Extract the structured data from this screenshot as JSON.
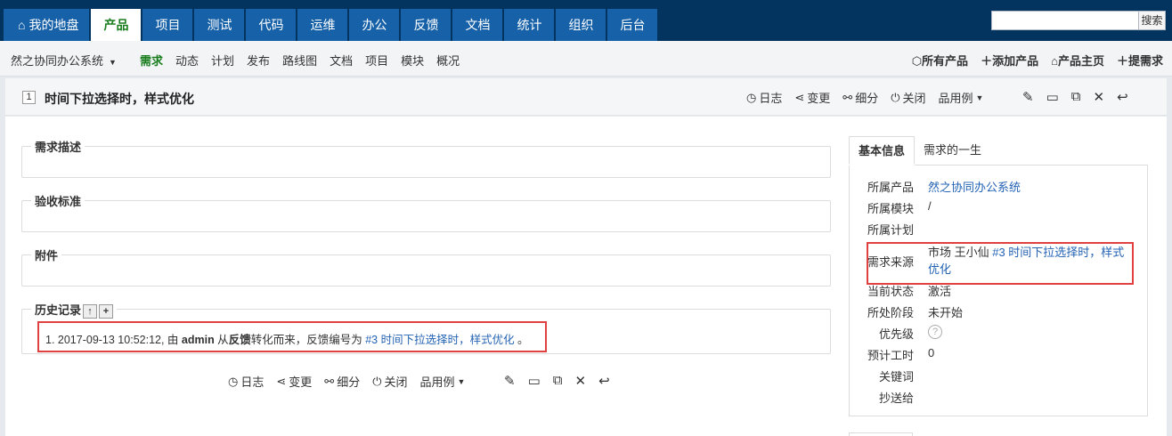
{
  "nav": {
    "tabs": [
      "我的地盘",
      "产品",
      "项目",
      "测试",
      "代码",
      "运维",
      "办公",
      "反馈",
      "文档",
      "统计",
      "组织",
      "后台"
    ],
    "active_tab": 1,
    "search_placeholder": "",
    "search_button": "搜索"
  },
  "subnav": {
    "product": "然之协同办公系统",
    "items": [
      "需求",
      "动态",
      "计划",
      "发布",
      "路线图",
      "文档",
      "项目",
      "模块",
      "概况"
    ],
    "active_item": 0,
    "right": [
      "所有产品",
      "添加产品",
      "产品主页",
      "提需求"
    ]
  },
  "story": {
    "id": "1",
    "title": "时间下拉选择时，样式优化",
    "actions": [
      "日志",
      "变更",
      "细分",
      "关闭",
      "品用例"
    ]
  },
  "sections": {
    "desc": "需求描述",
    "acceptance": "验收标准",
    "attachments": "附件",
    "history": "历史记录"
  },
  "history": {
    "prefix": "1. 2017-09-13 10:52:12, 由 ",
    "user": "admin",
    "mid1": " 从",
    "source": "反馈",
    "mid2": "转化而来，反馈编号为 ",
    "link": "#3 时间下拉选择时，样式优化",
    "suffix": " 。"
  },
  "side": {
    "tabs": [
      "基本信息",
      "需求的一生"
    ],
    "active_tab": 0,
    "fields": {
      "product_label": "所属产品",
      "product": "然之协同办公系统",
      "module_label": "所属模块",
      "module": "/",
      "plan_label": "所属计划",
      "plan": "",
      "source_label": "需求来源",
      "source_text": "市场 王小仙 ",
      "source_link_1": "#3 时间下拉选择时，样式",
      "source_link_2": "优化",
      "status_label": "当前状态",
      "status": "激活",
      "stage_label": "所处阶段",
      "stage": "未开始",
      "pri_label": "优先级",
      "pri": "?",
      "estimate_label": "预计工时",
      "estimate": "0",
      "keywords_label": "关键词",
      "keywords": "",
      "mailto_label": "抄送给",
      "mailto": ""
    }
  }
}
